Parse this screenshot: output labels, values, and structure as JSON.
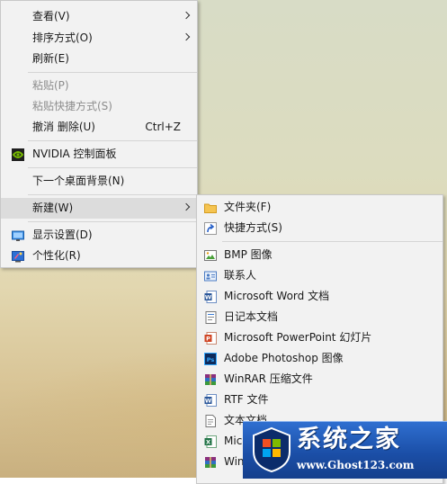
{
  "main_menu": {
    "items": [
      {
        "label": "查看(V)",
        "shortcut": "",
        "disabled": false,
        "submenu": true
      },
      {
        "label": "排序方式(O)",
        "shortcut": "",
        "disabled": false,
        "submenu": true
      },
      {
        "label": "刷新(E)",
        "shortcut": "",
        "disabled": false,
        "submenu": false
      },
      {
        "label": "粘贴(P)",
        "shortcut": "",
        "disabled": true,
        "submenu": false
      },
      {
        "label": "粘贴快捷方式(S)",
        "shortcut": "",
        "disabled": true,
        "submenu": false
      },
      {
        "label": "撤消 删除(U)",
        "shortcut": "Ctrl+Z",
        "disabled": false,
        "submenu": false
      },
      {
        "label": "NVIDIA 控制面板",
        "shortcut": "",
        "disabled": false,
        "submenu": false,
        "icon": "nvidia-icon"
      },
      {
        "label": "下一个桌面背景(N)",
        "shortcut": "",
        "disabled": false,
        "submenu": false
      },
      {
        "label": "新建(W)",
        "shortcut": "",
        "disabled": false,
        "submenu": true,
        "highlighted": true
      },
      {
        "label": "显示设置(D)",
        "shortcut": "",
        "disabled": false,
        "submenu": false,
        "icon": "display-settings-icon"
      },
      {
        "label": "个性化(R)",
        "shortcut": "",
        "disabled": false,
        "submenu": false,
        "icon": "personalize-icon"
      }
    ]
  },
  "new_submenu": {
    "items": [
      {
        "label": "文件夹(F)",
        "icon": "folder-icon"
      },
      {
        "label": "快捷方式(S)",
        "icon": "shortcut-icon"
      },
      {
        "label": "BMP 图像",
        "icon": "bmp-image-icon"
      },
      {
        "label": "联系人",
        "icon": "contact-icon"
      },
      {
        "label": "Microsoft Word 文档",
        "icon": "word-document-icon"
      },
      {
        "label": "日记本文档",
        "icon": "journal-document-icon"
      },
      {
        "label": "Microsoft PowerPoint 幻灯片",
        "icon": "powerpoint-icon"
      },
      {
        "label": "Adobe Photoshop 图像",
        "icon": "photoshop-icon"
      },
      {
        "label": "WinRAR 压缩文件",
        "icon": "winrar-icon"
      },
      {
        "label": "RTF 文件",
        "icon": "rtf-document-icon"
      },
      {
        "label": "文本文档",
        "icon": "text-document-icon"
      },
      {
        "label": "Mic",
        "icon": "excel-icon"
      },
      {
        "label": "Win",
        "icon": "winrar-zip-icon"
      }
    ]
  },
  "watermark": {
    "title": "系统之家",
    "url": "www.Ghost123.com"
  },
  "colors": {
    "menu_background": "#f2f2f2",
    "hover_background": "#dcdcdc",
    "disabled_text": "#8d8d8d",
    "watermark_blue": "#1b4fa8"
  }
}
